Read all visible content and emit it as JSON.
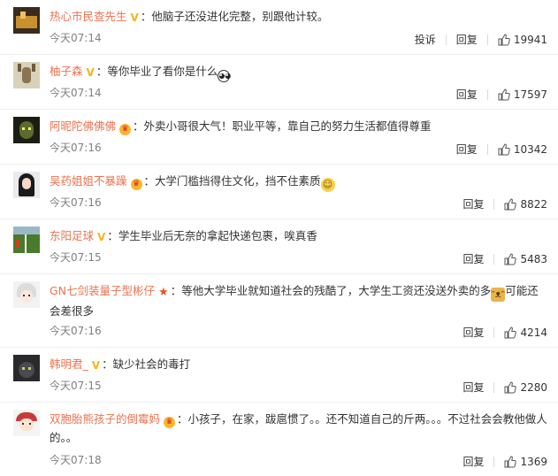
{
  "labels": {
    "report": "投诉",
    "reply": "回复"
  },
  "comments": [
    {
      "user": "热心市民查先生",
      "badge": "v",
      "text": "：他脑子还没进化完整，别跟他计较。",
      "time": "今天07:14",
      "likes": "19941",
      "show_report": true,
      "emoji": ""
    },
    {
      "user": "柚子森",
      "badge": "v",
      "text": "：等你毕业了看你是什么",
      "time": "今天07:14",
      "likes": "17597",
      "show_report": false,
      "emoji": "panda-emoji"
    },
    {
      "user": "阿昵陀佛佛佛",
      "badge": "crown",
      "text": "：外卖小哥很大气！职业平等，靠自己的努力生活都值得尊重",
      "time": "今天07:16",
      "likes": "10342",
      "show_report": false,
      "emoji": ""
    },
    {
      "user": "吴药姐姐不暴躁",
      "badge": "crown",
      "text": "：大学门槛挡得住文化，挡不住素质",
      "time": "今天07:16",
      "likes": "8822",
      "show_report": false,
      "emoji": "grimace-emoji"
    },
    {
      "user": "东阳足球",
      "badge": "v",
      "text": "：学生毕业后无奈的拿起快递包裹，唉真香",
      "time": "今天07:15",
      "likes": "5483",
      "show_report": false,
      "emoji": ""
    },
    {
      "user": "GN七剑装量子型彬仔",
      "badge": "star",
      "text": "：等他大学毕业就知道社会的残酷了，大学生工资还没送外卖的多",
      "text2": "可能还会差很多",
      "time": "今天07:16",
      "likes": "4214",
      "show_report": false,
      "emoji": "doge-emoji"
    },
    {
      "user": "韩明君_",
      "badge": "v",
      "text": "：缺少社会的毒打",
      "time": "今天07:15",
      "likes": "2280",
      "show_report": false,
      "emoji": ""
    },
    {
      "user": "双胞胎熊孩子的倒霉妈",
      "badge": "crown",
      "text": "：小孩子，在家，跋扈惯了。。还不知道自己的斤两。。。不过社会会教他做人的。。",
      "time": "今天07:18",
      "likes": "1369",
      "show_report": false,
      "emoji": ""
    }
  ]
}
